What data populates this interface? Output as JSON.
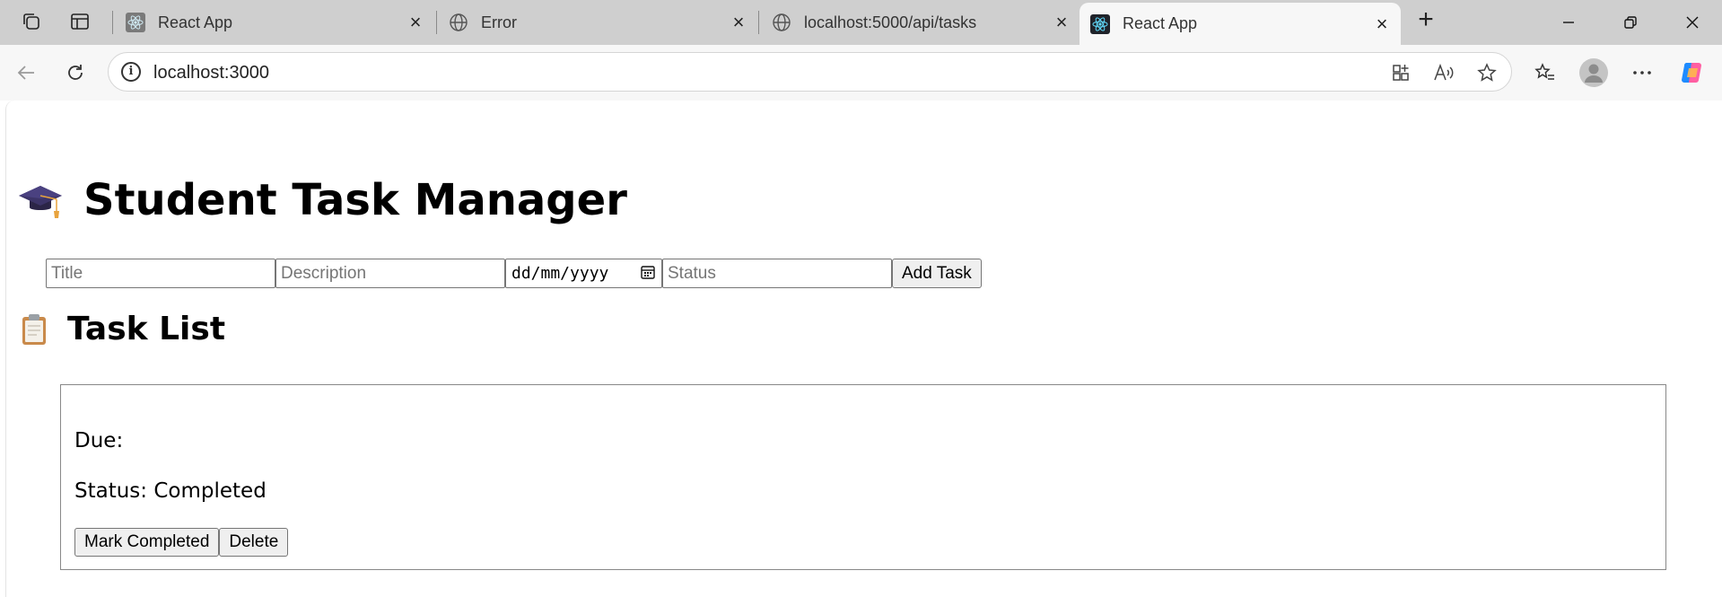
{
  "browser": {
    "tabs": [
      {
        "title": "React App",
        "favicon": "react-logo-icon",
        "active": false
      },
      {
        "title": "Error",
        "favicon": "globe-icon",
        "active": false
      },
      {
        "title": "localhost:5000/api/tasks",
        "favicon": "globe-icon",
        "active": false
      },
      {
        "title": "React App",
        "favicon": "react-logo-icon",
        "active": true
      }
    ],
    "address": "localhost:3000"
  },
  "app": {
    "title": "Student Task Manager",
    "form": {
      "title_placeholder": "Title",
      "description_placeholder": "Description",
      "date_placeholder": "dd/mm/yyyy",
      "status_placeholder": "Status",
      "add_label": "Add Task"
    },
    "list_title": "Task List",
    "tasks": [
      {
        "title": "",
        "due_label": "Due:",
        "status_label": "Status: Completed",
        "complete_label": "Mark Completed",
        "delete_label": "Delete"
      }
    ]
  },
  "colors": {
    "tabbar": "#cfcfcf",
    "toolbar": "#f7f7f7",
    "react_accent": "#61dafb"
  }
}
